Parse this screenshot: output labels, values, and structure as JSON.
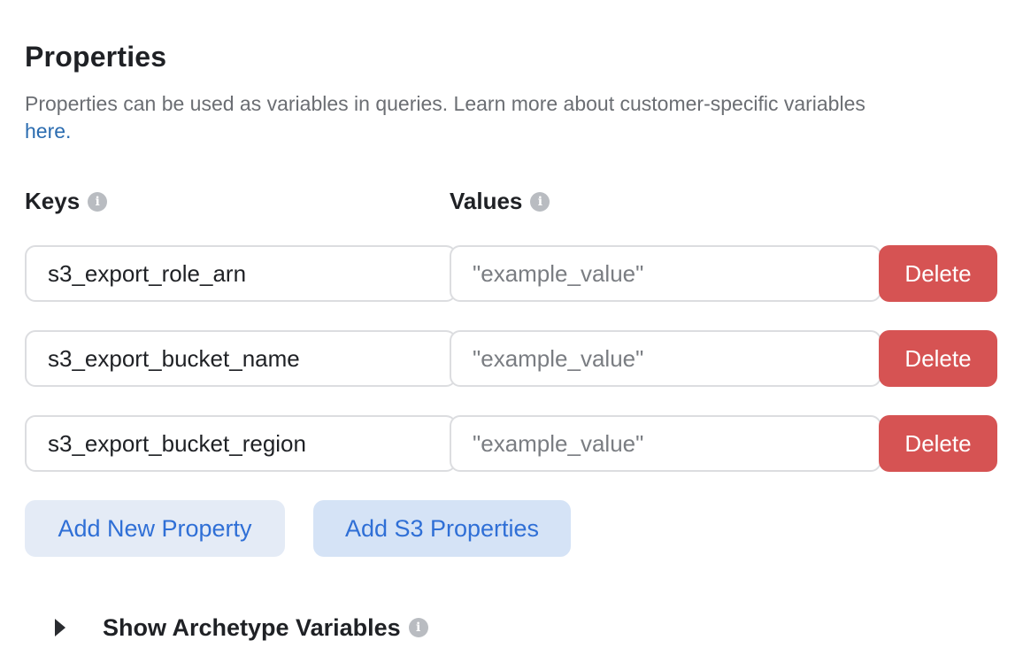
{
  "properties": {
    "title": "Properties",
    "description": "Properties can be used as variables in queries. Learn more about customer-specific variables",
    "link_text": "here."
  },
  "columns": {
    "keys_label": "Keys",
    "values_label": "Values",
    "info_icon": "info-icon"
  },
  "rows": [
    {
      "key": "s3_export_role_arn",
      "value": "",
      "value_placeholder": "\"example_value\"",
      "delete_label": "Delete"
    },
    {
      "key": "s3_export_bucket_name",
      "value": "",
      "value_placeholder": "\"example_value\"",
      "delete_label": "Delete"
    },
    {
      "key": "s3_export_bucket_region",
      "value": "",
      "value_placeholder": "\"example_value\"",
      "delete_label": "Delete"
    }
  ],
  "actions": {
    "add_new_label": "Add New Property",
    "add_s3_label": "Add S3 Properties"
  },
  "archetype": {
    "label": "Show Archetype Variables",
    "icon": "caret-right-icon"
  },
  "colors": {
    "delete": "#d65353",
    "link": "#2b6cb0",
    "action_text": "#2f6fd6",
    "action_bg": "#e4ebf6",
    "action_bg_active": "#d5e3f6"
  }
}
